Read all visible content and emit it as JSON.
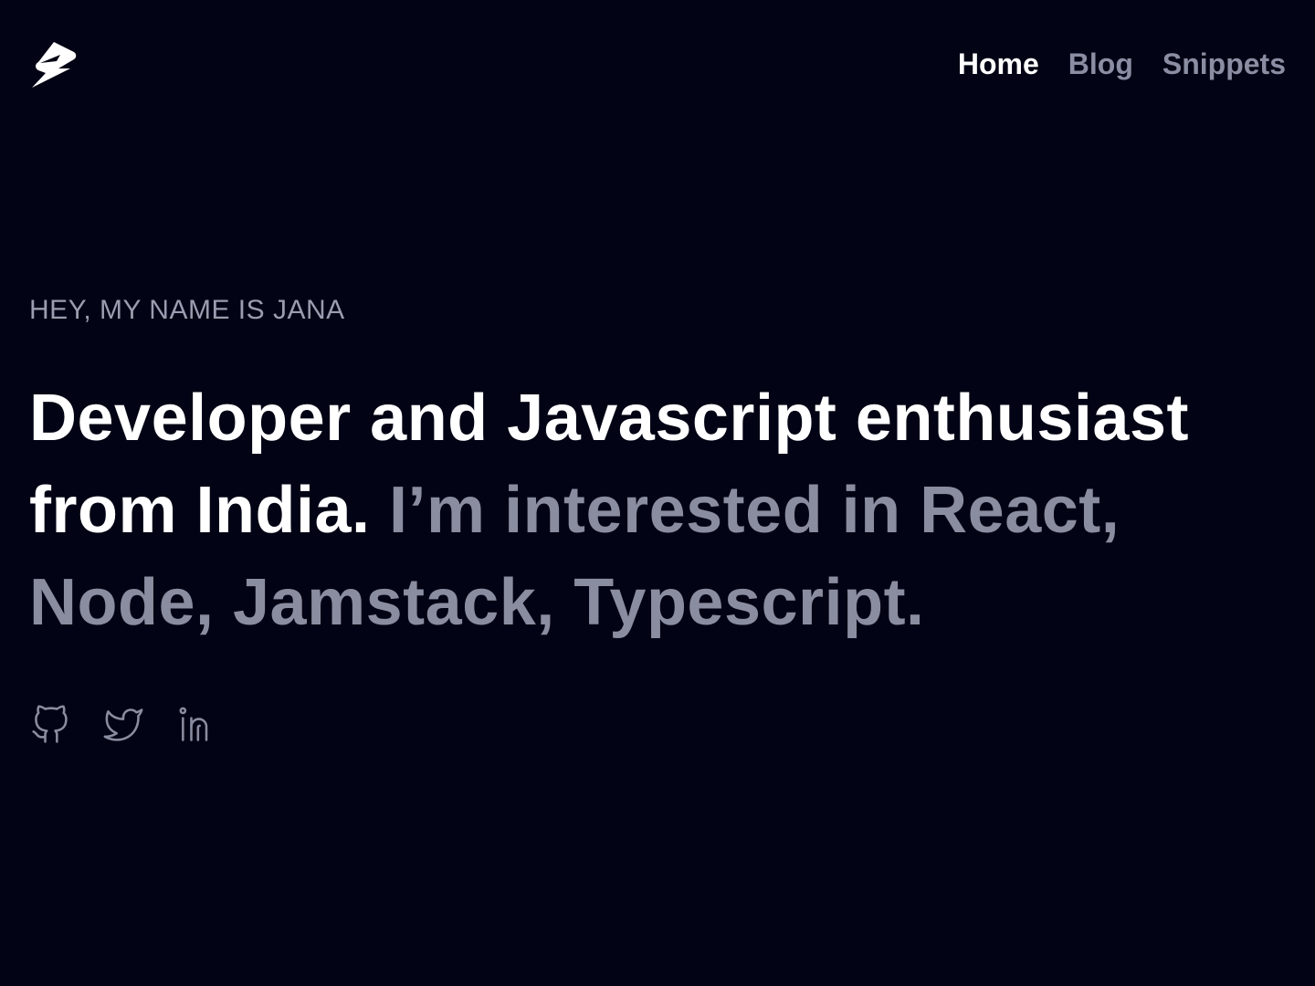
{
  "header": {
    "logo_icon": "lightning-bolt-icon",
    "nav": [
      {
        "label": "Home",
        "active": true
      },
      {
        "label": "Blog",
        "active": false
      },
      {
        "label": "Snippets",
        "active": false
      }
    ]
  },
  "hero": {
    "eyebrow": "HEY, MY NAME IS JANA",
    "headline_strong": "Developer and Javascript enthusiast from India.",
    "headline_muted": "I’m interested in React, Node, Jamstack, Typescript."
  },
  "socials": [
    {
      "icon": "github-icon"
    },
    {
      "icon": "twitter-icon"
    },
    {
      "icon": "linkedin-icon"
    }
  ],
  "colors": {
    "background": "#020314",
    "text_primary": "#ffffff",
    "text_muted": "#8a8d9f"
  }
}
